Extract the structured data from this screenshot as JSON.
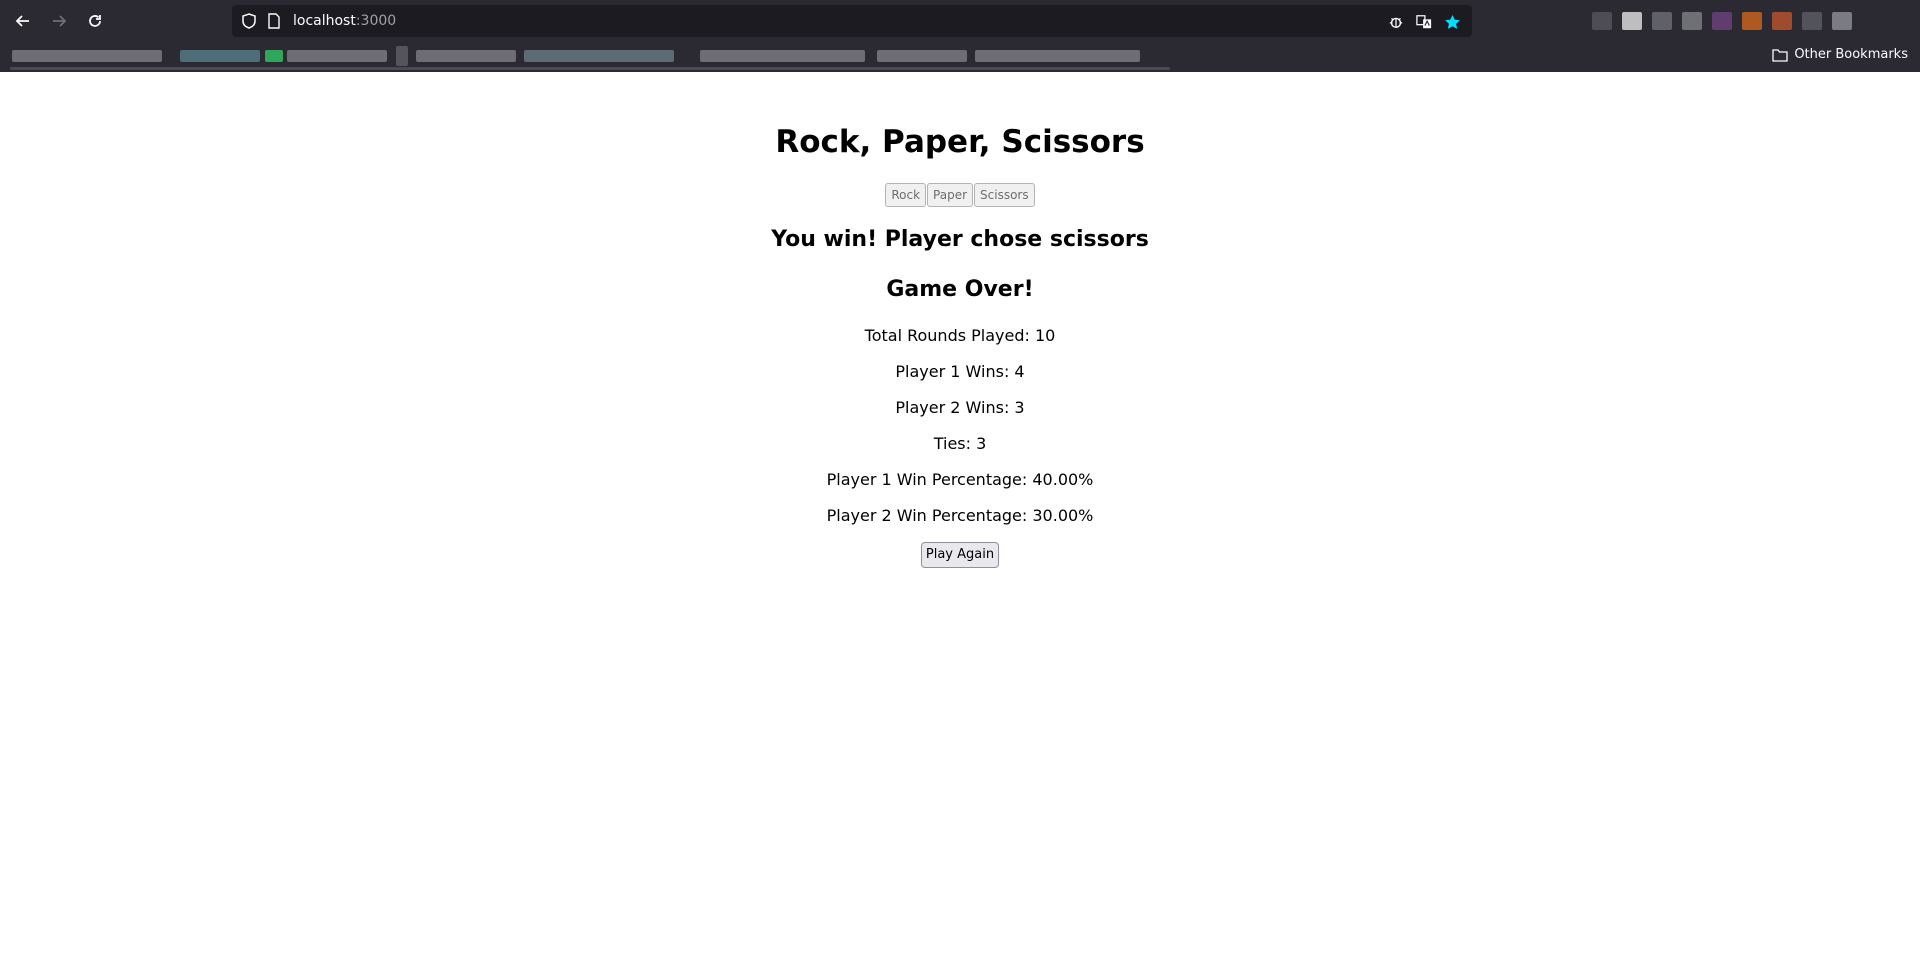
{
  "browser": {
    "url_host": "localhost",
    "url_port": ":3000",
    "other_bookmarks_label": "Other Bookmarks",
    "accent_star_color": "#00ddff"
  },
  "game": {
    "title": "Rock, Paper, Scissors",
    "choices": [
      "Rock",
      "Paper",
      "Scissors"
    ],
    "result_text": "You win! Player chose scissors",
    "game_over_text": "Game Over!",
    "stats": [
      "Total Rounds Played: 10",
      "Player 1 Wins: 4",
      "Player 2 Wins: 3",
      "Ties: 3",
      "Player 1 Win Percentage: 40.00%",
      "Player 2 Win Percentage: 30.00%"
    ],
    "play_again_label": "Play Again"
  }
}
